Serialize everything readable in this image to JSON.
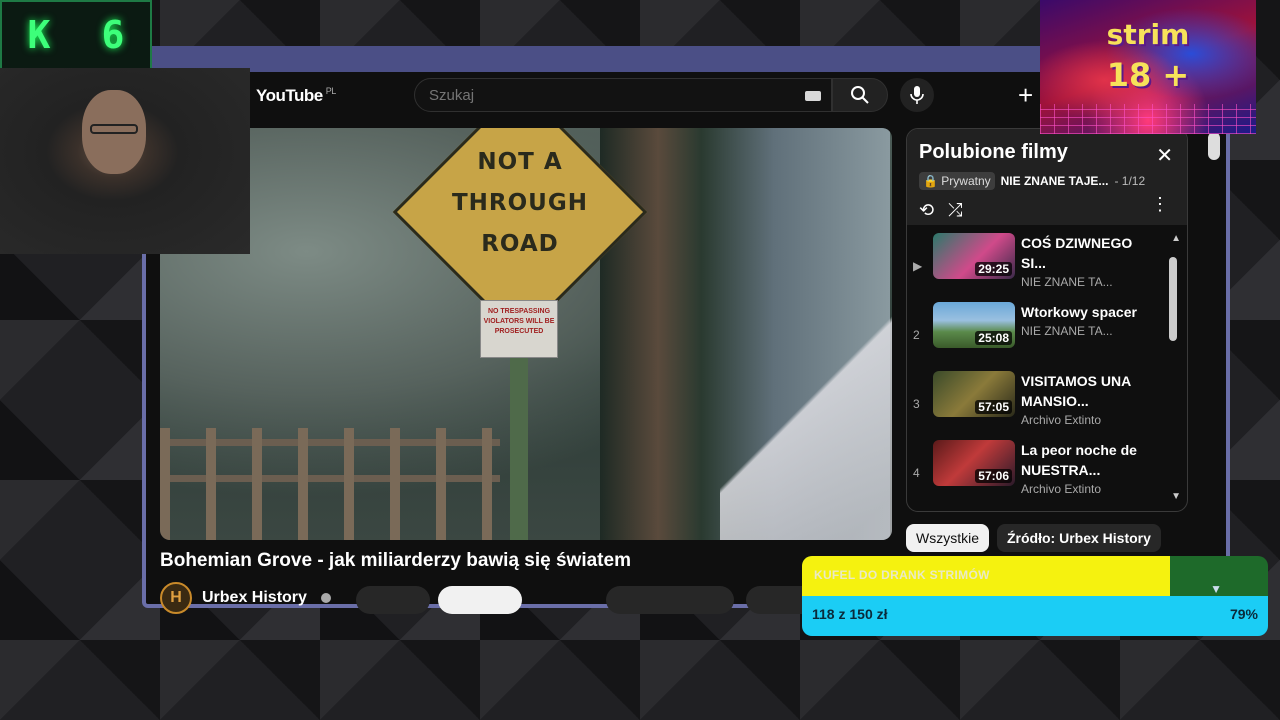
{
  "overlay": {
    "counter": {
      "left": "K",
      "right": "6"
    },
    "strim": {
      "line1": "strim",
      "line2": "18 +"
    }
  },
  "youtube": {
    "logo": "YouTube",
    "logo_region": "PL",
    "search": {
      "placeholder": "Szukaj",
      "value": ""
    },
    "create_label": "+",
    "video": {
      "title": "Bohemian Grove - jak miliarderzy bawią się światem",
      "channel": "Urbex History",
      "channel_initial": "H",
      "sign_text": "NOT A THROUGH ROAD",
      "small_sign_lines": [
        "NO TRESPASSING",
        "VIOLATORS WILL BE",
        "PROSECUTED"
      ]
    },
    "playlist": {
      "title": "Polubione filmy",
      "privacy": "Prywatny",
      "current_name": "NIE ZNANE TAJE...",
      "position": "- 1/12",
      "items": [
        {
          "index": "▶",
          "title": "COŚ DZIWNEGO SI...",
          "channel": "NIE ZNANE TA...",
          "duration": "29:25"
        },
        {
          "index": "2",
          "title": "Wtorkowy spacer",
          "channel": "NIE ZNANE TA...",
          "duration": "25:08"
        },
        {
          "index": "3",
          "title": "VISITAMOS UNA MANSIO...",
          "channel": "Archivo Extinto",
          "duration": "57:05"
        },
        {
          "index": "4",
          "title": "La peor noche de NUESTRA...",
          "channel": "Archivo Extinto",
          "duration": "57:06"
        }
      ]
    },
    "chips": {
      "all": "Wszystkie",
      "source": "Źródło: Urbex History"
    }
  },
  "goal": {
    "title": "KUFEL DO DRANK STRIMÓW",
    "amount": "118 z 150 zł",
    "percent_label": "79%",
    "progress": 0.79
  },
  "colors": {
    "goal_fill": "#f5f20f",
    "goal_bar": "#1bcdf5",
    "counter_green": "#3dff7a",
    "window_frame": "#4b4f86"
  }
}
